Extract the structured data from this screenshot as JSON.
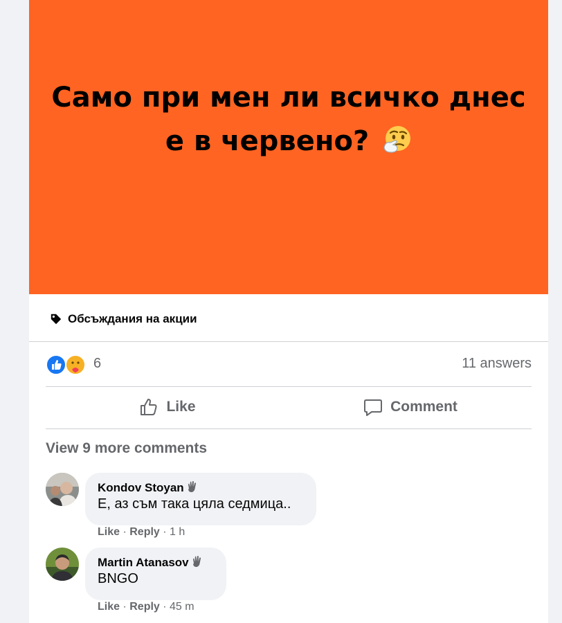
{
  "post": {
    "banner_text_line1": "Само при мен ли всичко днес",
    "banner_text_line2": "е в червено?",
    "banner_color": "#ff6422",
    "topic_icon": "tag-icon",
    "topic": "Обсъждания на акции",
    "reaction_icons": [
      "like-reaction-icon",
      "care-reaction-icon"
    ],
    "reaction_count": "6",
    "answers": "11 answers",
    "like_label": "Like",
    "comment_label": "Comment"
  },
  "comments_section": {
    "view_more": "View 9 more comments",
    "comments": [
      {
        "author": "Kondov Stoyan",
        "badge_icon": "wave-hand-icon",
        "text": "Е, аз съм така цяла седмица..",
        "like": "Like",
        "reply": "Reply",
        "time": "1 h"
      },
      {
        "author": "Martin Atanasov",
        "badge_icon": "wave-hand-icon",
        "text": "BNGO",
        "like": "Like",
        "reply": "Reply",
        "time": "45 m"
      }
    ]
  }
}
